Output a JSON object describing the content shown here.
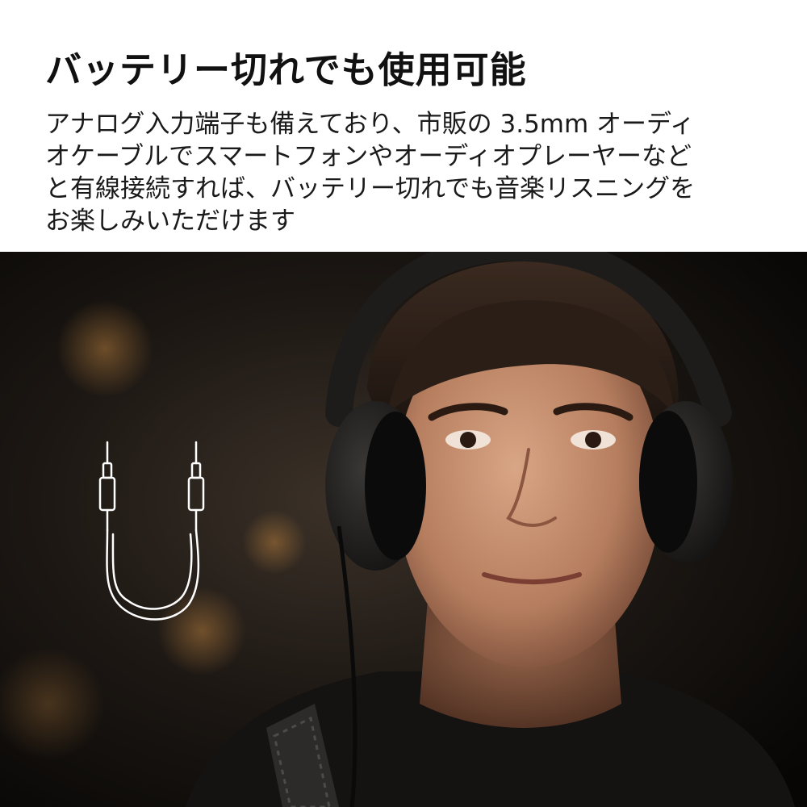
{
  "headline": "バッテリー切れでも使用可能",
  "body_lines": [
    "アナログ入力端子も備えており、市販の 3.5mm オーディ",
    "オケーブルでスマートフォンやオーディオプレーヤーなど",
    "と有線接続すれば、バッテリー切れでも音楽リスニングを",
    "お楽しみいただけます"
  ],
  "photo": {
    "subject": "man-wearing-over-ear-headphones",
    "icon": "audio-cable-icon",
    "background_color": "#0d0c0b",
    "icon_color": "#ffffff"
  }
}
